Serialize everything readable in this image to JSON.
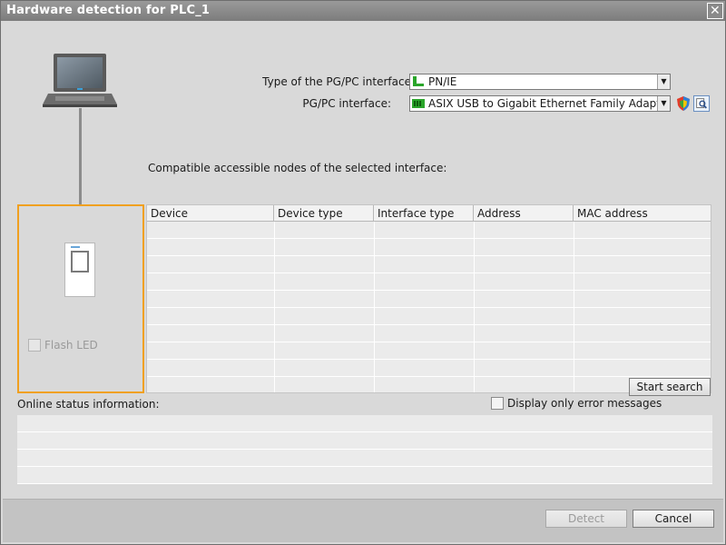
{
  "window": {
    "title": "Hardware detection for PLC_1",
    "close_glyph": "✕"
  },
  "interface": {
    "type_label": "Type of the PG/PC interface:",
    "type_value": "PN/IE",
    "pgpc_label": "PG/PC interface:",
    "pgpc_value": "ASIX USB to Gigabit Ethernet Family Adapter...",
    "dropdown_glyph": "▼"
  },
  "nodes": {
    "label": "Compatible accessible nodes of the selected interface:",
    "columns": [
      "Device",
      "Device type",
      "Interface type",
      "Address",
      "MAC address"
    ],
    "rows": []
  },
  "device_panel": {
    "flash_led_label": "Flash LED",
    "flash_led_checked": false
  },
  "search": {
    "start_search_label": "Start search"
  },
  "status": {
    "label": "Online status information:",
    "error_only_label": "Display only error messages",
    "error_only_checked": false
  },
  "footer": {
    "detect_label": "Detect",
    "cancel_label": "Cancel"
  },
  "colors": {
    "accent_orange": "#f0a020",
    "title_bar": "#8a8a8a",
    "network_green": "#2aa52a"
  },
  "icons": {
    "laptop": "laptop-icon",
    "plc": "plc-device-icon",
    "pnie": "network-port-icon",
    "adapter": "network-adapter-icon",
    "shield": "shield-icon",
    "properties": "magnifier-icon"
  }
}
